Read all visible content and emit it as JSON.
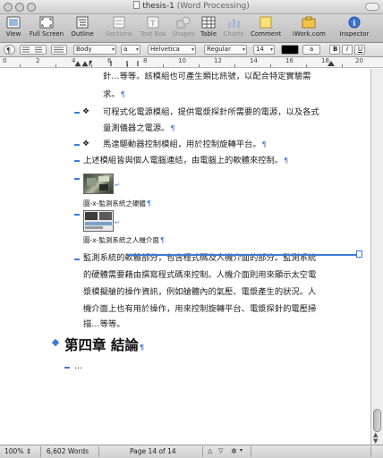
{
  "window": {
    "title": "thesis-1",
    "subtitle": "(Word Processing)"
  },
  "toolbar": {
    "items": [
      {
        "label": "View",
        "icon": "view-icon"
      },
      {
        "label": "Full Screen",
        "icon": "full-screen-icon"
      },
      {
        "label": "Outline",
        "icon": "outline-icon"
      },
      {
        "label": "Sections",
        "icon": "sections-icon"
      },
      {
        "label": "Text Box",
        "icon": "text-box-icon"
      },
      {
        "label": "Shapes",
        "icon": "shapes-icon"
      },
      {
        "label": "Table",
        "icon": "table-icon"
      },
      {
        "label": "Charts",
        "icon": "charts-icon"
      },
      {
        "label": "Comment",
        "icon": "comment-icon"
      },
      {
        "label": "iWork.com",
        "icon": "iwork-icon"
      },
      {
        "label": "Inspector",
        "icon": "inspector-icon"
      }
    ]
  },
  "format_bar": {
    "paragraph_style": "Body",
    "char_style": "a",
    "font": "Helvetica",
    "weight": "Regular",
    "size": "14",
    "text_color_label": "a",
    "bold": "B",
    "italic": "I",
    "underline": "U"
  },
  "ruler": {
    "numbers": [
      "0",
      "2",
      "4",
      "6",
      "8",
      "10",
      "12",
      "14",
      "16",
      "18",
      "20"
    ]
  },
  "document": {
    "lines": [
      {
        "text": "針…等等。該模組也可產生類比訊號，以配合特定實驗需"
      },
      {
        "text": "求。"
      },
      {
        "text": "可程式化電源模組，提供電漿探針所需要的電源，以及各式"
      },
      {
        "text": "量測儀器之電源。"
      },
      {
        "text": "馬達驅動器控制模組，用於控制旋轉平台。"
      },
      {
        "text": "上述模組皆與個人電腦連結，由電腦上的軟體來控制。"
      },
      {
        "text": "監測系統的軟體部分，包含程式碼及人機介面的部分。監測系統"
      },
      {
        "text": "的硬體需要藉由撰寫程式碼來控制。人機介面則用來顯示太空電"
      },
      {
        "text": "漿模擬艙的操作資訊，例如艙體內的氣壓、電漿產生的狀況。人"
      },
      {
        "text": "機介面上也有用於操作，用來控制旋轉平台、電漿探針的電壓掃"
      },
      {
        "text": "描…等等。"
      },
      {
        "text": "…"
      }
    ],
    "bullet_glyph": "❖",
    "pilcrow": "¶",
    "figure1_caption": "圖-x-監測系統之硬體",
    "figure2_caption": "圖-x-監測系統之人機介面",
    "heading": "第四章 結論"
  },
  "status_bar": {
    "zoom": "100%",
    "words": "6,602 Words",
    "page": "Page 14 of 14"
  },
  "colors": {
    "accent": "#3f7ad6"
  }
}
